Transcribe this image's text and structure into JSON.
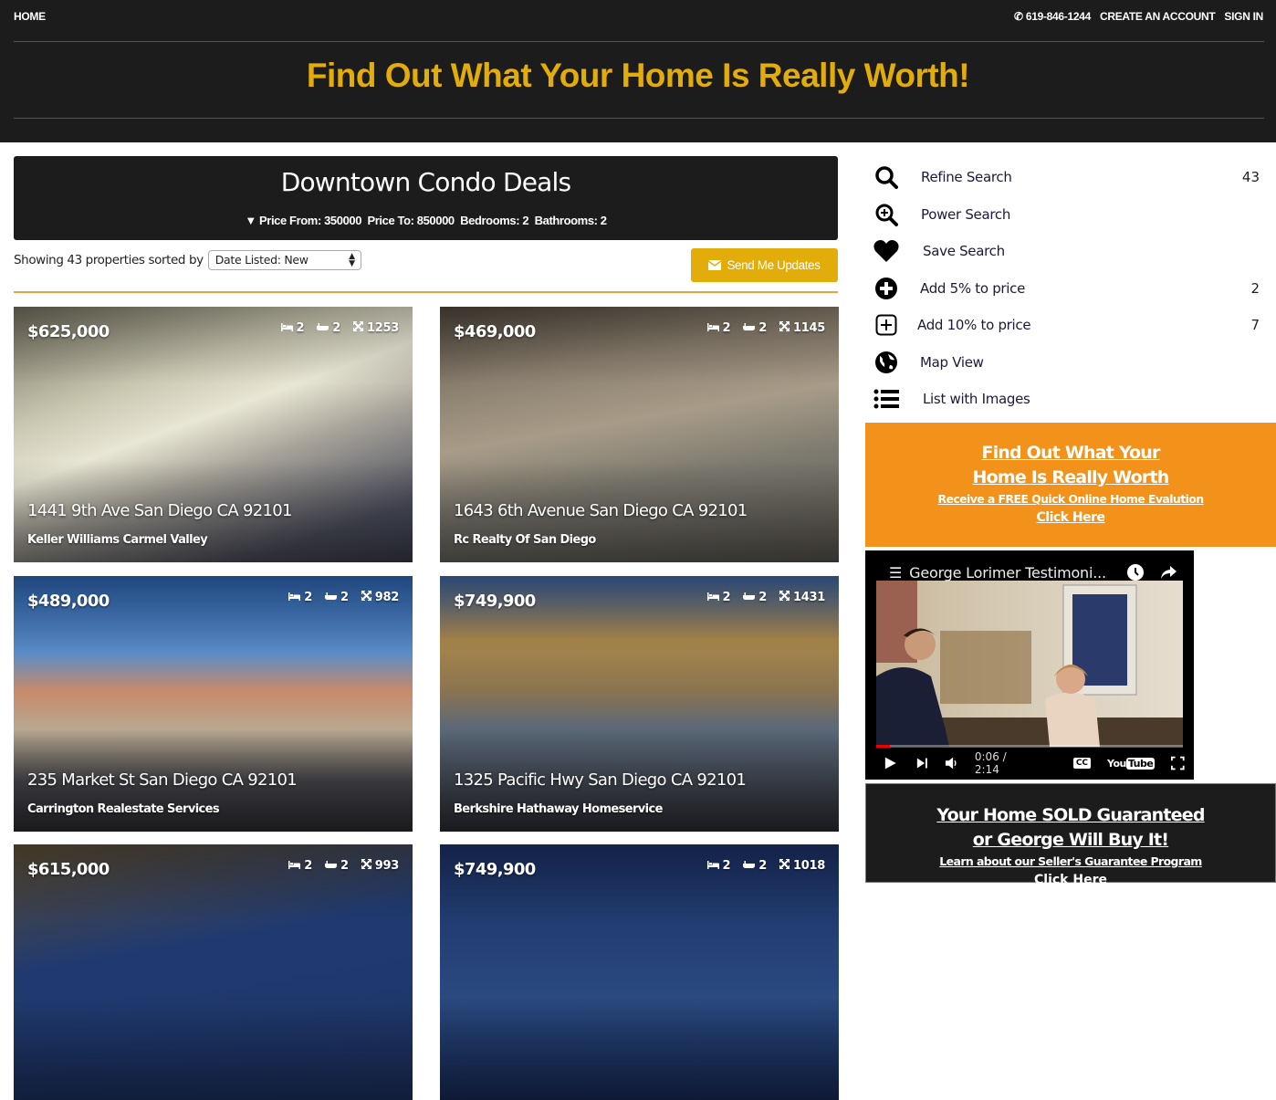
{
  "topnav": {
    "home": "HOME",
    "phone": "619-846-1244",
    "create_account": "CREATE AN ACCOUNT",
    "sign_in": "SIGN IN"
  },
  "banner": {
    "title": "Find Out What Your Home Is Really Worth!"
  },
  "search": {
    "title": "Downtown Condo Deals",
    "filters": "Price From: 350000  Price To: 850000  Bedrooms: 2  Bathrooms: 2",
    "sort_prefix": "Showing 43 properties sorted by",
    "sort_value": "Date Listed: New",
    "send_updates": "Send Me Updates"
  },
  "listings": [
    {
      "price": "$625,000",
      "beds": "2",
      "baths": "2",
      "sqft": "1253",
      "address": "1441 9th Ave San Diego CA 92101",
      "agent": "Keller Williams Carmel Valley"
    },
    {
      "price": "$469,000",
      "beds": "2",
      "baths": "2",
      "sqft": "1145",
      "address": "1643 6th Avenue San Diego CA 92101",
      "agent": "Rc Realty Of San Diego"
    },
    {
      "price": "$489,000",
      "beds": "2",
      "baths": "2",
      "sqft": "982",
      "address": "235 Market St San Diego CA 92101",
      "agent": "Carrington Realestate Services"
    },
    {
      "price": "$749,900",
      "beds": "2",
      "baths": "2",
      "sqft": "1431",
      "address": "1325 Pacific Hwy San Diego CA 92101",
      "agent": "Berkshire Hathaway Homeservice"
    },
    {
      "price": "$615,000",
      "beds": "2",
      "baths": "2",
      "sqft": "993",
      "address": "",
      "agent": ""
    },
    {
      "price": "$749,900",
      "beds": "2",
      "baths": "2",
      "sqft": "1018",
      "address": "",
      "agent": ""
    }
  ],
  "sidebar": {
    "items": [
      {
        "icon": "search-icon",
        "label": "Refine Search",
        "count": "43"
      },
      {
        "icon": "zoom-in-icon",
        "label": "Power Search",
        "count": ""
      },
      {
        "icon": "heart-icon",
        "label": "Save Search",
        "count": ""
      },
      {
        "icon": "plus-circle-icon",
        "label": "Add 5% to price",
        "count": "2"
      },
      {
        "icon": "plus-square-icon",
        "label": "Add 10% to price",
        "count": "7"
      },
      {
        "icon": "globe-icon",
        "label": "Map View",
        "count": ""
      },
      {
        "icon": "list-icon",
        "label": "List with Images",
        "count": ""
      }
    ]
  },
  "promo_valuation": {
    "line1": "Find Out What Your",
    "line2": "Home Is Really Worth",
    "sub": "Receive a FREE Quick Online Home Evalution",
    "cta": "Click Here",
    "color": "#f2921a"
  },
  "video": {
    "title": "George Lorimer Testimoni...",
    "time": "0:06 / 2:14",
    "progress": 0.045
  },
  "promo_guarantee": {
    "line1": "Your Home SOLD Guaranteed",
    "line2": "or George Will Buy It!",
    "sub": "Learn about our Seller's Guarantee Program",
    "cta": "Click Here"
  },
  "colors": {
    "accent_gold": "#e2ac0a",
    "dark": "#1c1c1c",
    "orange": "#f2921a"
  }
}
